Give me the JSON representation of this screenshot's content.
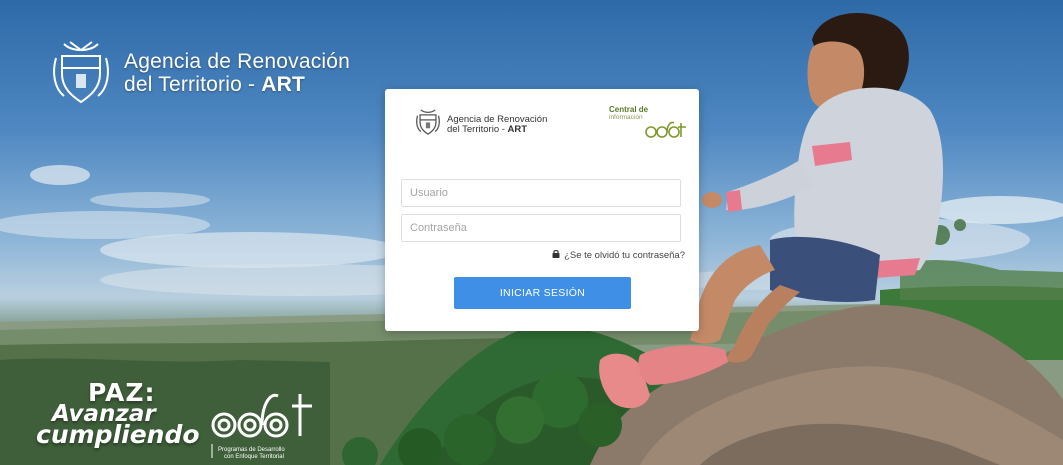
{
  "agency": {
    "line1": "Agencia de Renovación",
    "line2_prefix": "del Territorio - ",
    "line2_bold": "ART"
  },
  "card": {
    "header_line1": "Agencia de Renovación",
    "header_line2_prefix": "del Territorio - ",
    "header_line2_bold": "ART",
    "central_title": "Central de",
    "central_sub": "información",
    "central_logo_text": "pdet"
  },
  "login": {
    "username_placeholder": "Usuario",
    "password_placeholder": "Contraseña",
    "forgot_label": "¿Se te olvidó tu contraseña?",
    "submit_label": "INICIAR SESIÓN"
  },
  "slogan": {
    "line1": "PAZ:",
    "line2": "Avanzar",
    "line3": "cumpliendo"
  },
  "pdet_logo": {
    "text": "pdet",
    "caption": "Programas de Desarrollo con Enfoque Territorial"
  },
  "icons": {
    "lock": "lock-icon",
    "shield": "coat-of-arms-icon"
  }
}
